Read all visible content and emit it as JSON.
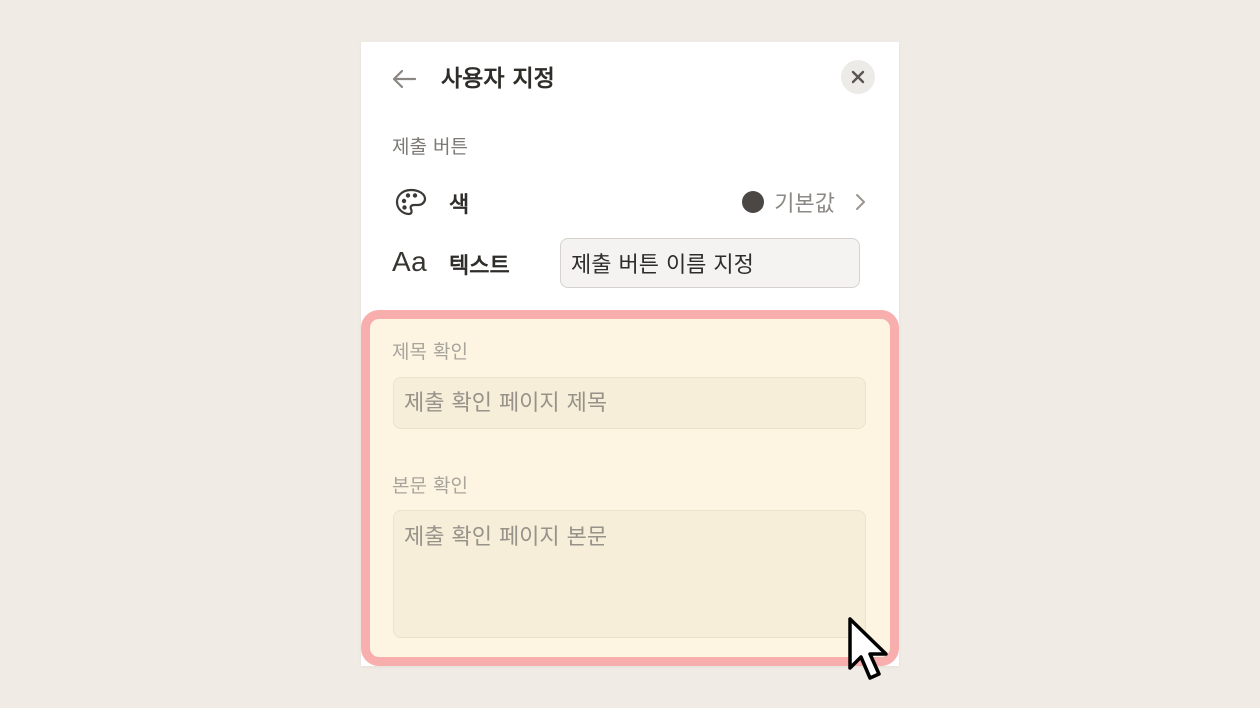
{
  "header": {
    "title": "사용자 지정"
  },
  "submit_button_section": {
    "label": "제출 버튼",
    "color_row": {
      "label": "색",
      "value": "기본값",
      "swatch_color": "#4a4745",
      "icon": "palette-icon"
    },
    "text_row": {
      "icon_text": "Aa",
      "label": "텍스트",
      "value": "제출 버튼 이름 지정"
    }
  },
  "confirmation": {
    "title_label": "제목 확인",
    "title_placeholder": "제출 확인 페이지 제목",
    "body_label": "본문 확인",
    "body_placeholder": "제출 확인 페이지 본문"
  },
  "colors": {
    "background": "#f0ebe5",
    "highlight_border": "#f7aeac",
    "highlight_fill": "#fdf5e2"
  }
}
